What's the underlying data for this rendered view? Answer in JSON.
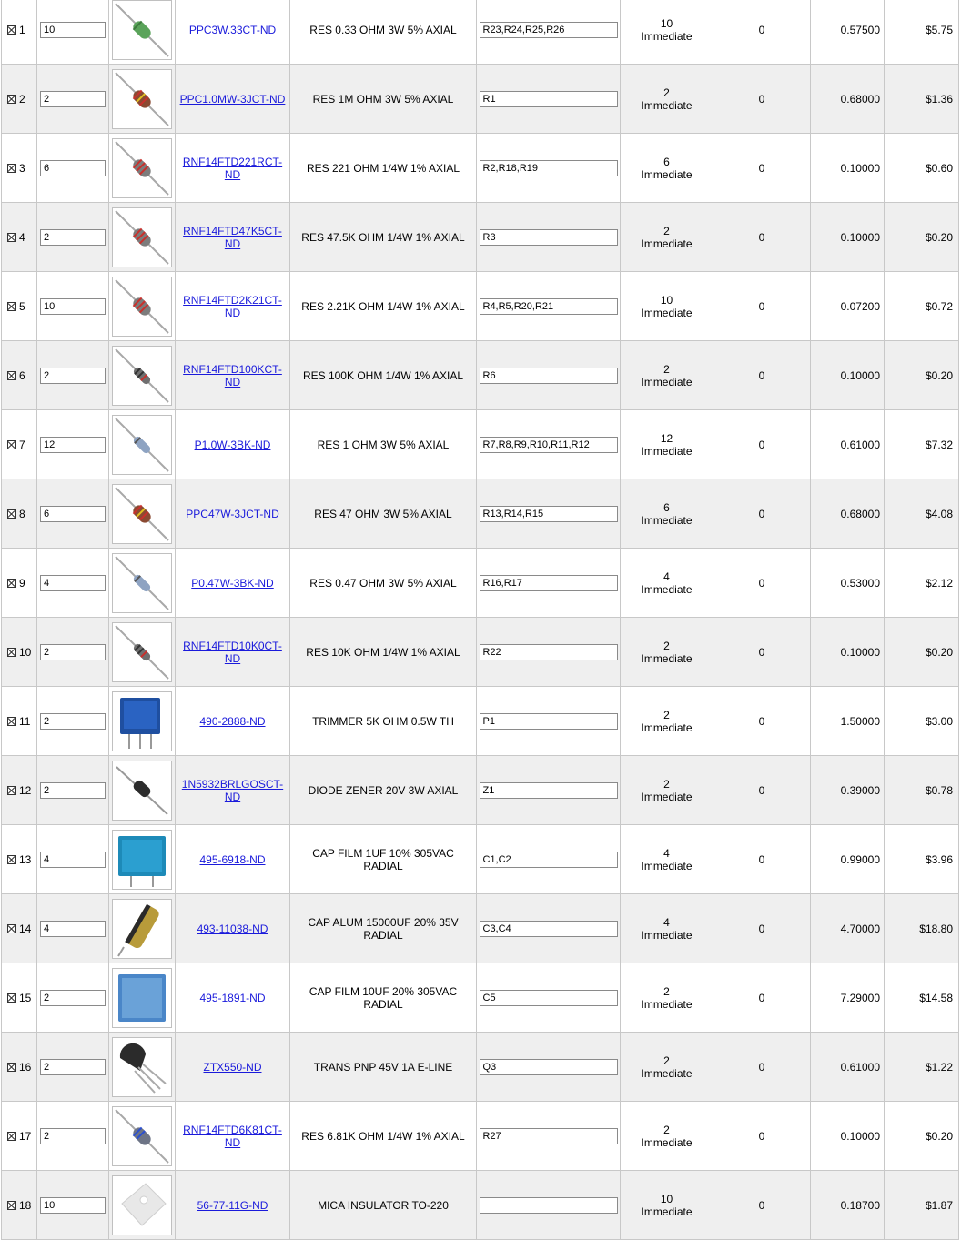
{
  "rows": [
    {
      "index": "1",
      "qty": "10",
      "part": "PPC3W.33CT-ND",
      "description": "RES 0.33 OHM 3W 5% AXIAL",
      "refdes": "R23,R24,R25,R26",
      "available": "10",
      "availability": "Immediate",
      "backorder": "0",
      "unit_price": "0.57500",
      "ext_price": "$5.75",
      "icon": "resistor-green-icon"
    },
    {
      "index": "2",
      "qty": "2",
      "part": "PPC1.0MW-3JCT-ND",
      "description": "RES 1M OHM 3W 5% AXIAL",
      "refdes": "R1",
      "available": "2",
      "availability": "Immediate",
      "backorder": "0",
      "unit_price": "0.68000",
      "ext_price": "$1.36",
      "icon": "resistor-brown-icon"
    },
    {
      "index": "3",
      "qty": "6",
      "part": "RNF14FTD221RCT-ND",
      "description": "RES 221 OHM 1/4W 1% AXIAL",
      "refdes": "R2,R18,R19",
      "available": "6",
      "availability": "Immediate",
      "backorder": "0",
      "unit_price": "0.10000",
      "ext_price": "$0.60",
      "icon": "resistor-gray-icon"
    },
    {
      "index": "4",
      "qty": "2",
      "part": "RNF14FTD47K5CT-ND",
      "description": "RES 47.5K OHM 1/4W 1% AXIAL",
      "refdes": "R3",
      "available": "2",
      "availability": "Immediate",
      "backorder": "0",
      "unit_price": "0.10000",
      "ext_price": "$0.20",
      "icon": "resistor-gray-icon"
    },
    {
      "index": "5",
      "qty": "10",
      "part": "RNF14FTD2K21CT-ND",
      "description": "RES 2.21K OHM 1/4W 1% AXIAL",
      "refdes": "R4,R5,R20,R21",
      "available": "10",
      "availability": "Immediate",
      "backorder": "0",
      "unit_price": "0.07200",
      "ext_price": "$0.72",
      "icon": "resistor-gray-icon"
    },
    {
      "index": "6",
      "qty": "2",
      "part": "RNF14FTD100KCT-ND",
      "description": "RES 100K OHM 1/4W 1% AXIAL",
      "refdes": "R6",
      "available": "2",
      "availability": "Immediate",
      "backorder": "0",
      "unit_price": "0.10000",
      "ext_price": "$0.20",
      "icon": "resistor-small-icon"
    },
    {
      "index": "7",
      "qty": "12",
      "part": "P1.0W-3BK-ND",
      "description": "RES 1 OHM 3W 5% AXIAL",
      "refdes": "R7,R8,R9,R10,R11,R12",
      "available": "12",
      "availability": "Immediate",
      "backorder": "0",
      "unit_price": "0.61000",
      "ext_price": "$7.32",
      "icon": "resistor-blue-icon"
    },
    {
      "index": "8",
      "qty": "6",
      "part": "PPC47W-3JCT-ND",
      "description": "RES 47 OHM 3W 5% AXIAL",
      "refdes": "R13,R14,R15",
      "available": "6",
      "availability": "Immediate",
      "backorder": "0",
      "unit_price": "0.68000",
      "ext_price": "$4.08",
      "icon": "resistor-brown-icon"
    },
    {
      "index": "9",
      "qty": "4",
      "part": "P0.47W-3BK-ND",
      "description": "RES 0.47 OHM 3W 5% AXIAL",
      "refdes": "R16,R17",
      "available": "4",
      "availability": "Immediate",
      "backorder": "0",
      "unit_price": "0.53000",
      "ext_price": "$2.12",
      "icon": "resistor-blue-icon"
    },
    {
      "index": "10",
      "qty": "2",
      "part": "RNF14FTD10K0CT-ND",
      "description": "RES 10K OHM 1/4W 1% AXIAL",
      "refdes": "R22",
      "available": "2",
      "availability": "Immediate",
      "backorder": "0",
      "unit_price": "0.10000",
      "ext_price": "$0.20",
      "icon": "resistor-small-icon"
    },
    {
      "index": "11",
      "qty": "2",
      "part": "490-2888-ND",
      "description": "TRIMMER 5K OHM 0.5W TH",
      "refdes": "P1",
      "available": "2",
      "availability": "Immediate",
      "backorder": "0",
      "unit_price": "1.50000",
      "ext_price": "$3.00",
      "icon": "trimmer-icon"
    },
    {
      "index": "12",
      "qty": "2",
      "part": "1N5932BRLGOSCT-ND",
      "description": "DIODE ZENER 20V 3W AXIAL",
      "refdes": "Z1",
      "available": "2",
      "availability": "Immediate",
      "backorder": "0",
      "unit_price": "0.39000",
      "ext_price": "$0.78",
      "icon": "diode-icon"
    },
    {
      "index": "13",
      "qty": "4",
      "part": "495-6918-ND",
      "description": "CAP FILM 1UF 10% 305VAC RADIAL",
      "refdes": "C1,C2",
      "available": "4",
      "availability": "Immediate",
      "backorder": "0",
      "unit_price": "0.99000",
      "ext_price": "$3.96",
      "icon": "film-cap-teal-icon"
    },
    {
      "index": "14",
      "qty": "4",
      "part": "493-11038-ND",
      "description": "CAP ALUM 15000UF 20% 35V RADIAL",
      "refdes": "C3,C4",
      "available": "4",
      "availability": "Immediate",
      "backorder": "0",
      "unit_price": "4.70000",
      "ext_price": "$18.80",
      "icon": "electrolytic-cap-icon"
    },
    {
      "index": "15",
      "qty": "2",
      "part": "495-1891-ND",
      "description": "CAP FILM 10UF 20% 305VAC RADIAL",
      "refdes": "C5",
      "available": "2",
      "availability": "Immediate",
      "backorder": "0",
      "unit_price": "7.29000",
      "ext_price": "$14.58",
      "icon": "film-cap-blue-icon"
    },
    {
      "index": "16",
      "qty": "2",
      "part": "ZTX550-ND",
      "description": "TRANS PNP 45V 1A E-LINE",
      "refdes": "Q3",
      "available": "2",
      "availability": "Immediate",
      "backorder": "0",
      "unit_price": "0.61000",
      "ext_price": "$1.22",
      "icon": "transistor-icon"
    },
    {
      "index": "17",
      "qty": "2",
      "part": "RNF14FTD6K81CT-ND",
      "description": "RES 6.81K OHM 1/4W 1% AXIAL",
      "refdes": "R27",
      "available": "2",
      "availability": "Immediate",
      "backorder": "0",
      "unit_price": "0.10000",
      "ext_price": "$0.20",
      "icon": "resistor-bluegray-icon"
    },
    {
      "index": "18",
      "qty": "10",
      "part": "56-77-11G-ND",
      "description": "MICA INSULATOR TO-220",
      "refdes": "",
      "available": "10",
      "availability": "Immediate",
      "backorder": "0",
      "unit_price": "0.18700",
      "ext_price": "$1.87",
      "icon": "mica-insulator-icon"
    }
  ]
}
